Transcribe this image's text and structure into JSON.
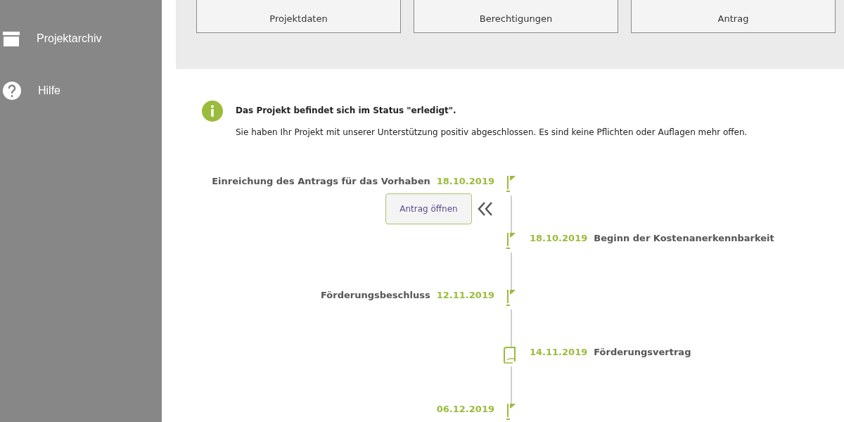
{
  "sidebar": {
    "items": [
      {
        "kind": "archive",
        "label": "Projektarchiv"
      },
      {
        "kind": "help",
        "label": "Hilfe"
      }
    ]
  },
  "tabs": [
    {
      "label": "Projektdaten"
    },
    {
      "label": "Berechtigungen"
    },
    {
      "label": "Antrag"
    }
  ],
  "info": {
    "title": "Das Projekt befindet sich im Status \"erledigt\".",
    "text": "Sie haben Ihr Projekt mit unserer Unterstützung positiv abgeschlossen. Es sind keine Pflichten oder Auflagen mehr offen."
  },
  "timeline": [
    {
      "on_left": true,
      "kind": "flag",
      "title": "Einreichung des Antrags für das Vorhaben",
      "date": "18.10.2019",
      "button": "Antrag öffnen"
    },
    {
      "on_left": false,
      "kind": "flag",
      "title": "Beginn der Kostenanerkennbarkeit",
      "date": "18.10.2019"
    },
    {
      "on_left": true,
      "kind": "flag",
      "title": "Förderungsbeschluss",
      "date": "12.11.2019"
    },
    {
      "on_left": false,
      "kind": "contract",
      "title": "Förderungsvertrag",
      "date": "14.11.2019"
    },
    {
      "on_left": true,
      "kind": "flag",
      "date": "06.12.2019"
    }
  ]
}
